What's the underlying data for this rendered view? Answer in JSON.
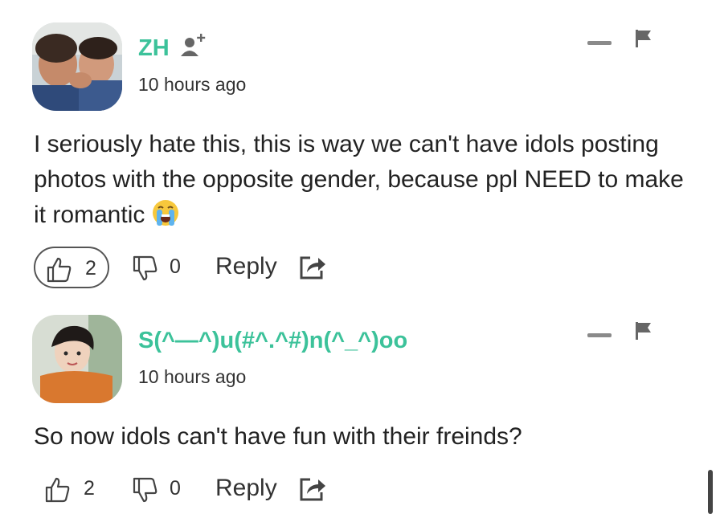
{
  "comments": [
    {
      "username": "ZH",
      "time": "10 hours ago",
      "text": "I seriously hate this, this is way we can't have idols posting photos with the opposite gender, because ppl NEED to make it romantic",
      "emoji": "loudly-crying-face",
      "likes": "2",
      "dislikes": "0",
      "reply_label": "Reply",
      "liked": true
    },
    {
      "username": "S(^—^)u(#^.^#)n(^_^)oo",
      "time": "10 hours ago",
      "text": "So now idols can't have fun with their freinds?",
      "likes": "2",
      "dislikes": "0",
      "reply_label": "Reply",
      "liked": false
    }
  ],
  "colors": {
    "username": "#3cc29a",
    "icon_gray": "#8a8a8a",
    "text": "#222222"
  },
  "icons": [
    "add-user-icon",
    "collapse-icon",
    "flag-icon",
    "thumbs-up-icon",
    "thumbs-down-icon",
    "share-icon"
  ]
}
